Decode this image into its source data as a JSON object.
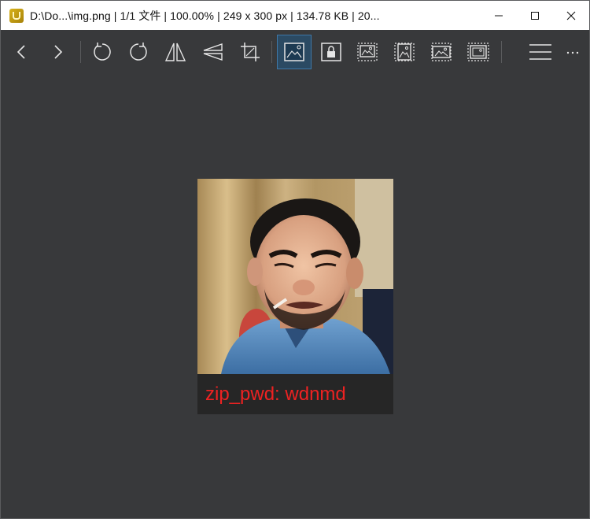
{
  "titlebar": {
    "title": "D:\\Do...\\img.png  |  1/1 文件  |  100.00%  |  249 x 300 px  |  134.78 KB  |  20...",
    "app_icon": "image-viewer-app-icon",
    "controls": [
      "minimize-icon",
      "maximize-icon",
      "close-icon"
    ]
  },
  "toolbar": {
    "buttons": [
      "previous-icon",
      "next-icon",
      "rotate-left-icon",
      "rotate-right-icon",
      "flip-horizontal-icon",
      "flip-vertical-icon",
      "crop-icon",
      "fit-window-icon",
      "lock-zoom-icon",
      "auto-zoom-icon",
      "scale-to-width-icon",
      "scale-to-height-icon",
      "fill-window-icon",
      "menu-icon",
      "more-icon"
    ],
    "active_button": "fit-window-icon",
    "accent_color": "#3e78a8"
  },
  "image": {
    "caption": "zip_pwd: wdnmd",
    "caption_color": "#ee2222",
    "alt": "photo"
  }
}
